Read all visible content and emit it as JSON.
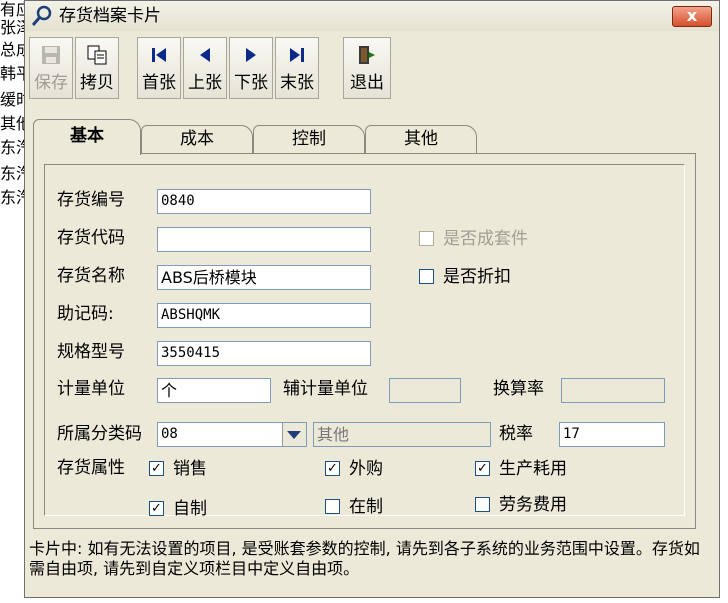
{
  "background_lines": [
    "有应",
    "张泽",
    "总成",
    "韩平",
    "缓时",
    "其他",
    "东汽",
    "东汽",
    "东汽"
  ],
  "window": {
    "title": "存货档案卡片",
    "close_label": "x"
  },
  "toolbar": {
    "save": "保存",
    "copy": "拷贝",
    "first": "首张",
    "prev": "上张",
    "next": "下张",
    "last": "末张",
    "exit": "退出"
  },
  "tabs": [
    "基本",
    "成本",
    "控制",
    "其他"
  ],
  "form": {
    "code_label": "存货编号",
    "code_value": "0840",
    "alias_label": "存货代码",
    "alias_value": "",
    "name_label": "存货名称",
    "name_value": "ABS后桥模块",
    "mnemonic_label": "助记码:",
    "mnemonic_value": "ABSHQMK",
    "spec_label": "规格型号",
    "spec_value": "3550415",
    "unit_label": "计量单位",
    "unit_value": "个",
    "aux_unit_label": "辅计量单位",
    "aux_unit_value": "",
    "rate_label": "换算率",
    "rate_value": "",
    "category_label": "所属分类码",
    "category_value": "08",
    "category_name": "其他",
    "tax_label": "税率",
    "tax_value": "17",
    "attr_label": "存货属性",
    "kit_label": "是否成套件",
    "discount_label": "是否折扣",
    "sale_label": "销售",
    "purchase_label": "外购",
    "production_label": "生产耗用",
    "self_made_label": "自制",
    "wip_label": "在制",
    "service_label": "劳务费用",
    "check_mark": "✓"
  },
  "checks": {
    "kit": false,
    "discount": false,
    "sale": true,
    "purchase": true,
    "production": true,
    "self_made": true,
    "wip": false,
    "service": false
  },
  "footer": {
    "hint": "卡片中: 如有无法设置的项目, 是受账套参数的控制, 请先到各子系统的业务范围中设置。存货如需自由项, 请先到自定义项栏目中定义自由项。"
  }
}
